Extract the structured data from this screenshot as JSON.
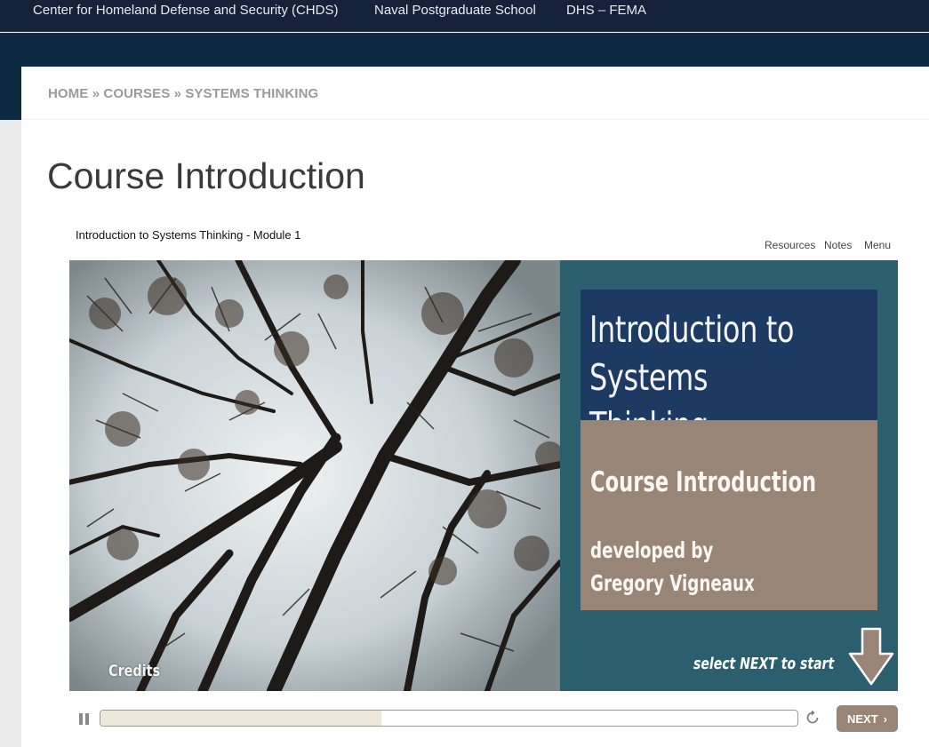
{
  "topnav": {
    "links": [
      "Center for Homeland Defense and Security (CHDS)",
      "Naval Postgraduate School",
      "DHS – FEMA"
    ]
  },
  "breadcrumb": {
    "items": [
      "HOME",
      "COURSES",
      "SYSTEMS THINKING"
    ],
    "separator": "»"
  },
  "page_title": "Course Introduction",
  "player": {
    "title": "Introduction to Systems Thinking - Module 1",
    "menu": [
      "Resources",
      "Notes",
      "Menu"
    ],
    "slide": {
      "heading": "Introduction to\nSystems Thinking",
      "subheading": "Course Introduction",
      "developed_by": "developed by",
      "author": "Gregory Vigneaux",
      "start_hint": "select NEXT to start",
      "credits": "Credits"
    },
    "progress": 0.403,
    "next_label": "NEXT"
  },
  "colors": {
    "topbar": "#16213a",
    "band": "#0e2a42",
    "title_box": "#1d3a62",
    "info_box": "#998575",
    "panel": "#2c5f6d"
  },
  "icons": [
    "pause-icon",
    "replay-icon",
    "chevron-right-icon",
    "down-arrow-icon"
  ]
}
